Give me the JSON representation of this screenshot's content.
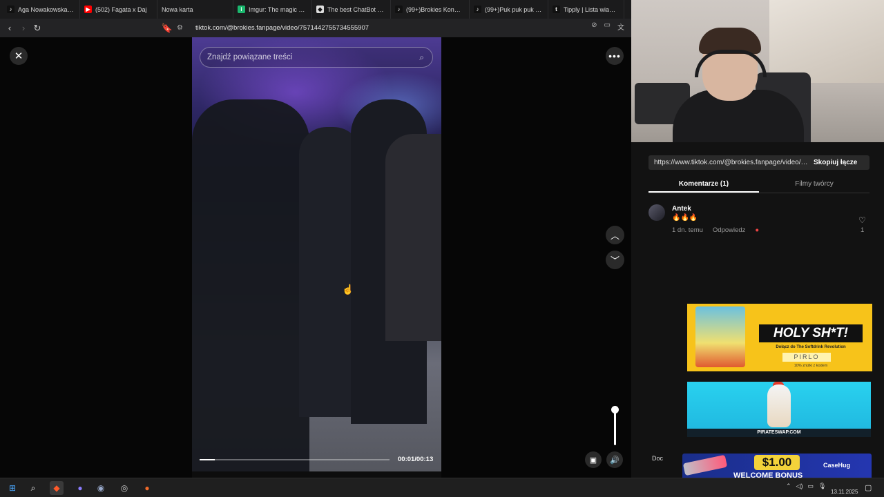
{
  "browser": {
    "tabs": [
      {
        "title": "Aga Nowakowska (@a",
        "icon": "tiktok-icon",
        "color": "#111111"
      },
      {
        "title": "(502) Fagata x Daj",
        "icon": "youtube-icon",
        "color": "#ff0000"
      },
      {
        "title": "Nowa karta",
        "icon": "",
        "color": ""
      },
      {
        "title": "Imgur: The magic of the",
        "icon": "imgur-icon",
        "color": "#1bb76e"
      },
      {
        "title": "The best ChatBot and",
        "icon": "chatbot-icon",
        "color": "#dddddd"
      },
      {
        "title": "(99+)Brokies Koncert h",
        "icon": "tiktok-icon",
        "color": "#111111"
      },
      {
        "title": "(99+)Puk puk puk puk (",
        "icon": "tiktok-icon",
        "color": "#111111"
      },
      {
        "title": "Tipply | Lista wiadomo",
        "icon": "tipply-icon",
        "color": "#111111"
      }
    ],
    "url": "tiktok.com/@brokies.fanpage/video/7571442755734555907"
  },
  "video": {
    "search_placeholder": "Znajdź powiązane treści",
    "time": "00:01/00:13",
    "progress": 0.08,
    "volume": 1.0
  },
  "panel": {
    "share_link": "https://www.tiktok.com/@brokies.fanpage/video/7...",
    "copy_label": "Skopiuj łącze",
    "tab_comments": "Komentarze (1)",
    "tab_creator": "Filmy twórcy",
    "comment": {
      "author": "Antek",
      "text": "🔥🔥🔥",
      "age": "1 dn. temu",
      "reply": "Odpowiedz",
      "likes": "1"
    }
  },
  "ads": {
    "ad1_headline": "HOLY SH*T!",
    "ad1_sub": "Dołącz do The Softdrink Revolution",
    "ad1_code": "PIRLO",
    "ad1_note": "10% zniżki z kodem",
    "ad2_label": "PIRATESWAP.COM",
    "ad3_prefix": "Doc",
    "ad3_price": "$1.00",
    "ad3_bonus": "WELCOME BONUS",
    "ad3_brand": "CaseHug"
  },
  "taskbar": {
    "date": "13.11.2025"
  }
}
